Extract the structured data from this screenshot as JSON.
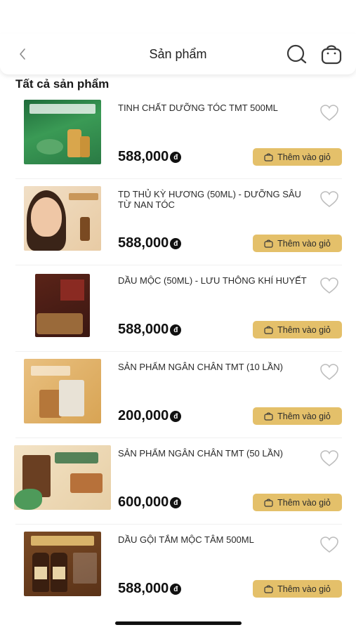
{
  "header": {
    "title": "Sản phẩm",
    "back_icon": "chevron-left-icon",
    "search_icon": "search-icon",
    "bag_icon": "shopping-bag-icon"
  },
  "section_title": "Tất cả sản phẩm",
  "currency_symbol": "đ",
  "add_to_cart_label": "Thêm vào giỏ",
  "products": [
    {
      "name": "TINH CHẤT DƯỠNG TÓC TMT 500ML",
      "price": "588,000"
    },
    {
      "name": "TD THỦ KỲ HƯƠNG (50ML) - DƯỠNG SÂU TỪ NAN TÓC",
      "price": "588,000"
    },
    {
      "name": "DẦU MỘC (50ML) - LƯU THÔNG KHÍ HUYẾT",
      "price": "588,000"
    },
    {
      "name": "SẢN PHẨM NGÂN CHÂN TMT (10 LẦN)",
      "price": "200,000"
    },
    {
      "name": "SẢN PHẨM NGÂN CHÂN TMT (50 LẦN)",
      "price": "600,000"
    },
    {
      "name": "DẦU GỘI TẮM MỘC TÂM 500ML",
      "price": "588,000"
    }
  ],
  "colors": {
    "accent": "#e4c06a",
    "text": "#1a1a1a"
  }
}
